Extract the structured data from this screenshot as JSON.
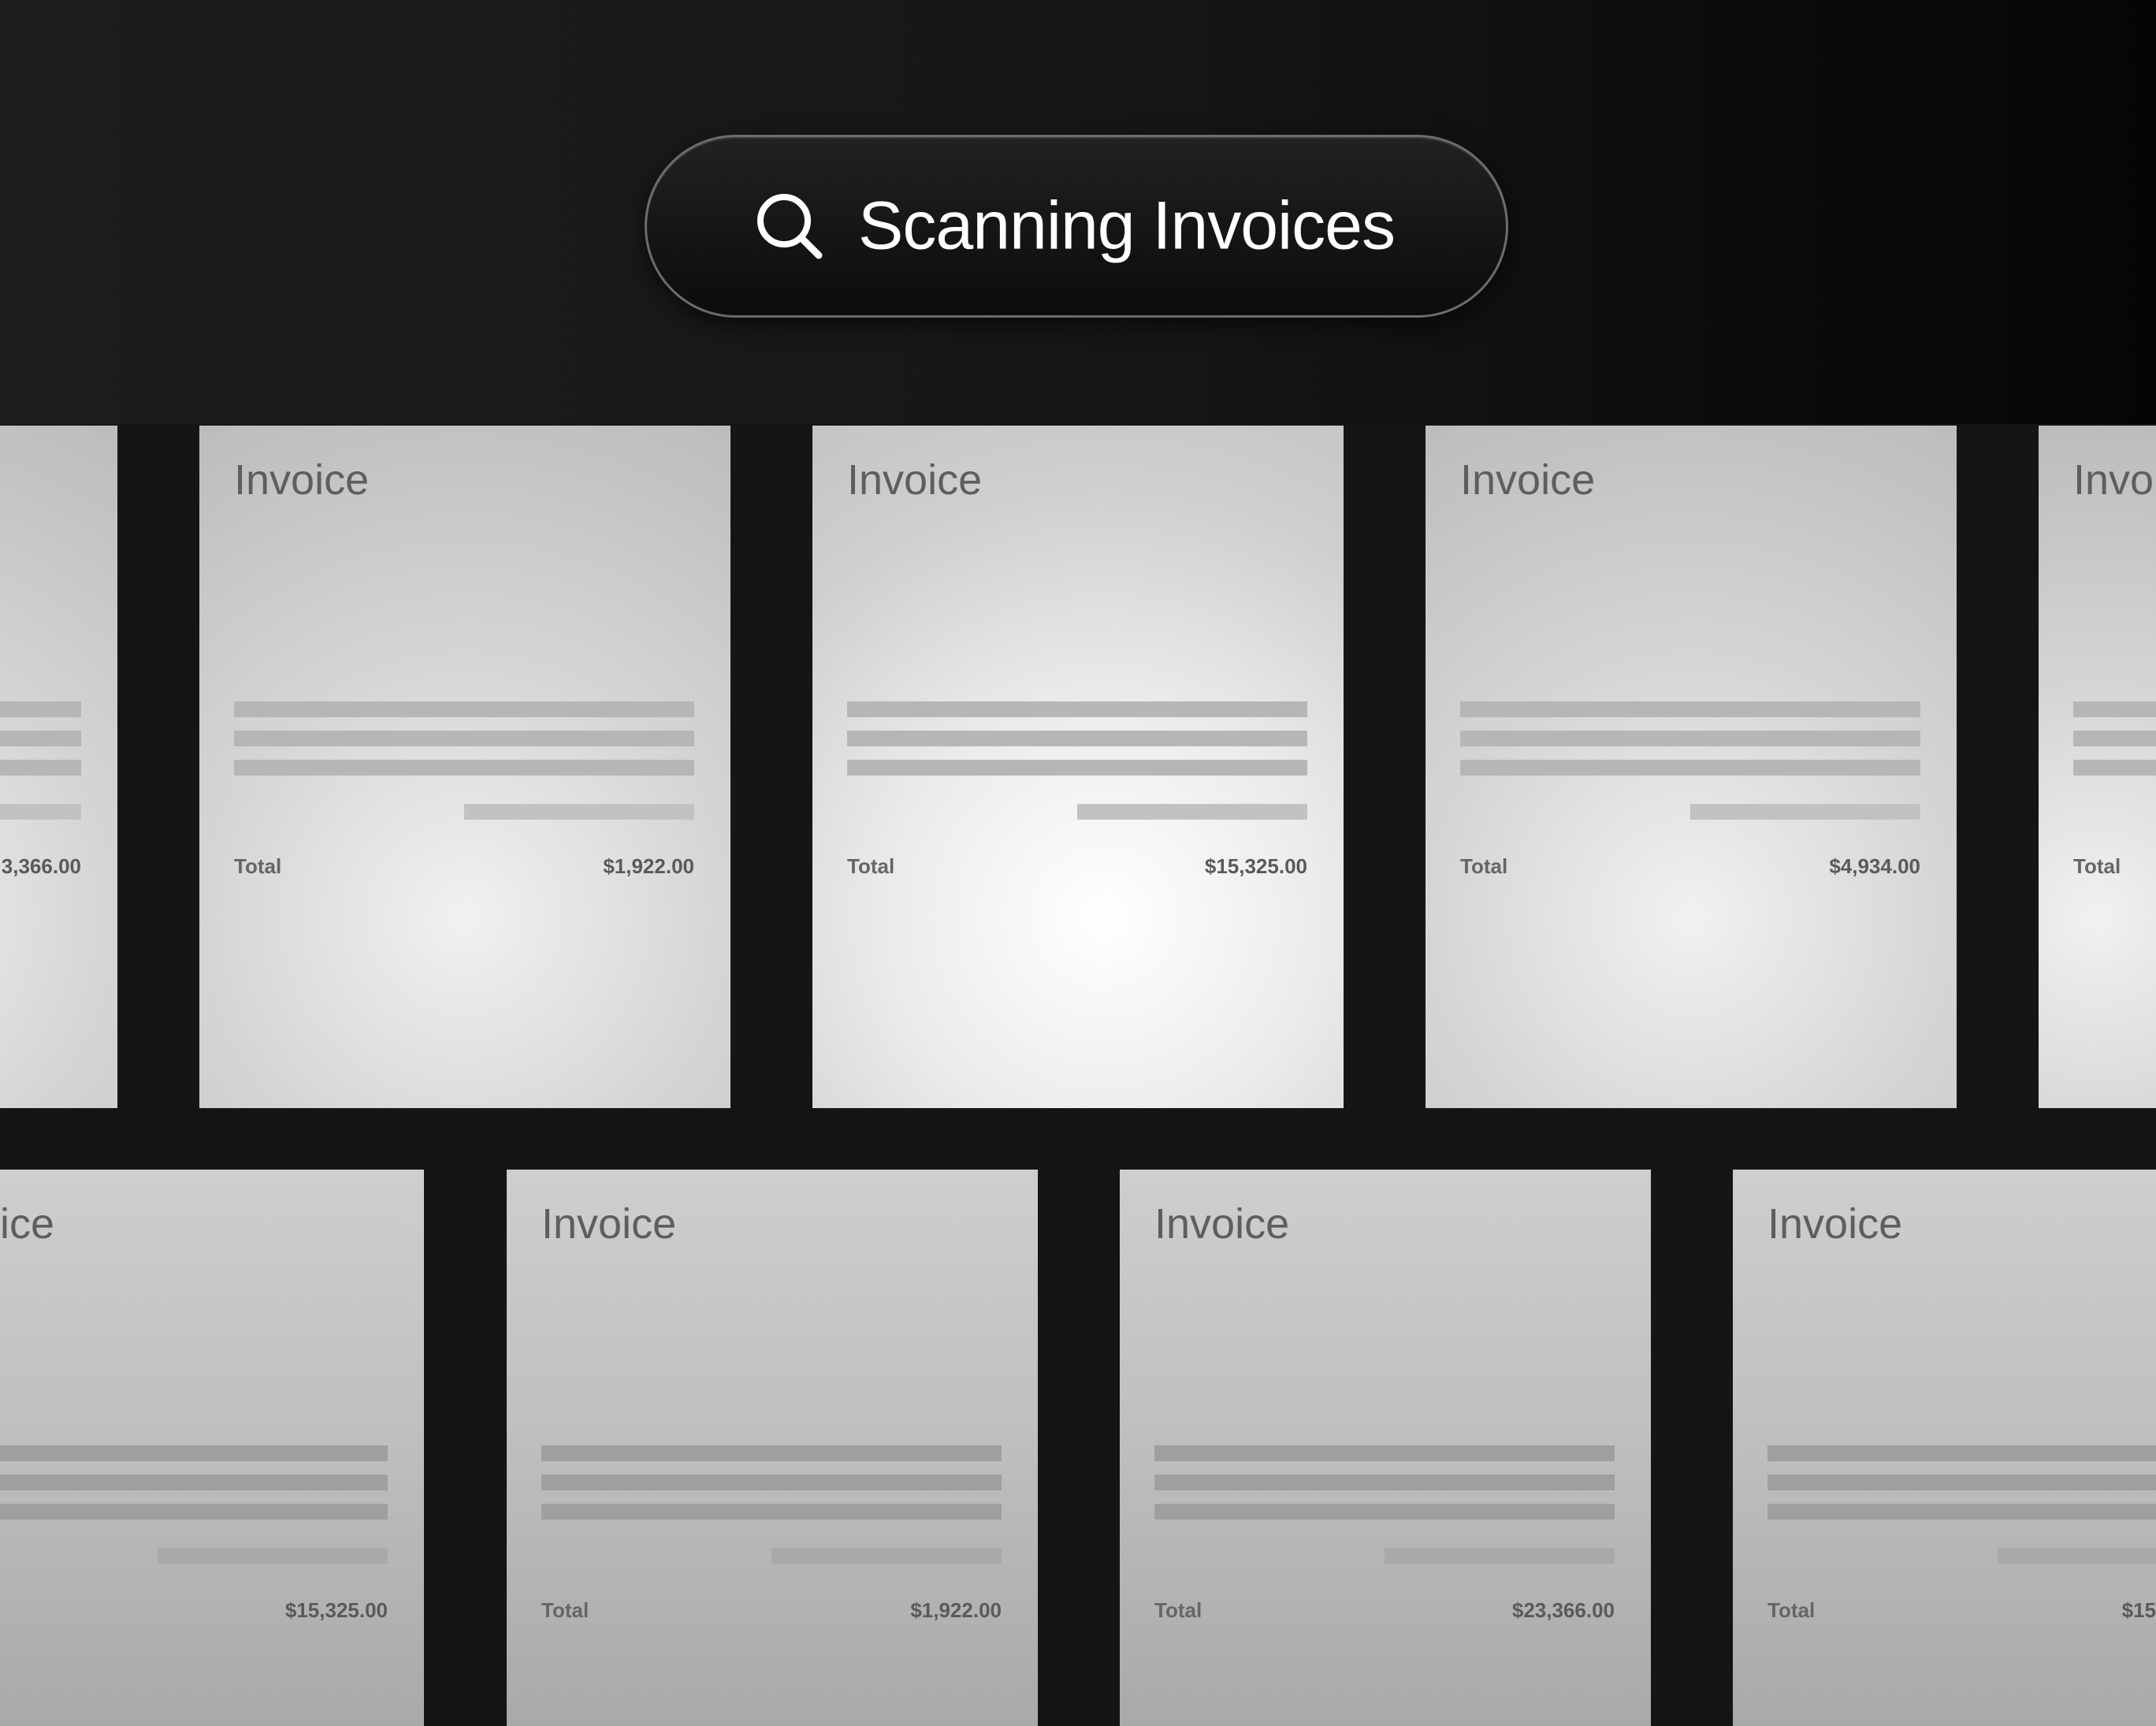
{
  "search": {
    "label": "Scanning Invoices",
    "icon": "search-icon"
  },
  "colors": {
    "background": "#151515",
    "header": "#1e1c1d",
    "pill_border": "#6c6c6c",
    "text_on_dark": "#ffffff",
    "card_light": "#f1f1f1",
    "card_text": "#5e5e5e"
  },
  "invoices": [
    {
      "title": "",
      "total_label": "",
      "amount": "3,366.00"
    },
    {
      "title": "Invoice",
      "total_label": "Total",
      "amount": "$1,922.00"
    },
    {
      "title": "Invoice",
      "total_label": "Total",
      "amount": "$15,325.00"
    },
    {
      "title": "Invoice",
      "total_label": "Total",
      "amount": "$4,934.00"
    },
    {
      "title": "Invo",
      "total_label": "Total",
      "amount": ""
    },
    {
      "title": "ice",
      "total_label": "",
      "amount": "$15,325.00"
    },
    {
      "title": "Invoice",
      "total_label": "Total",
      "amount": "$1,922.00"
    },
    {
      "title": "Invoice",
      "total_label": "Total",
      "amount": "$23,366.00"
    },
    {
      "title": "Invoice",
      "total_label": "Total",
      "amount": "$15"
    }
  ]
}
